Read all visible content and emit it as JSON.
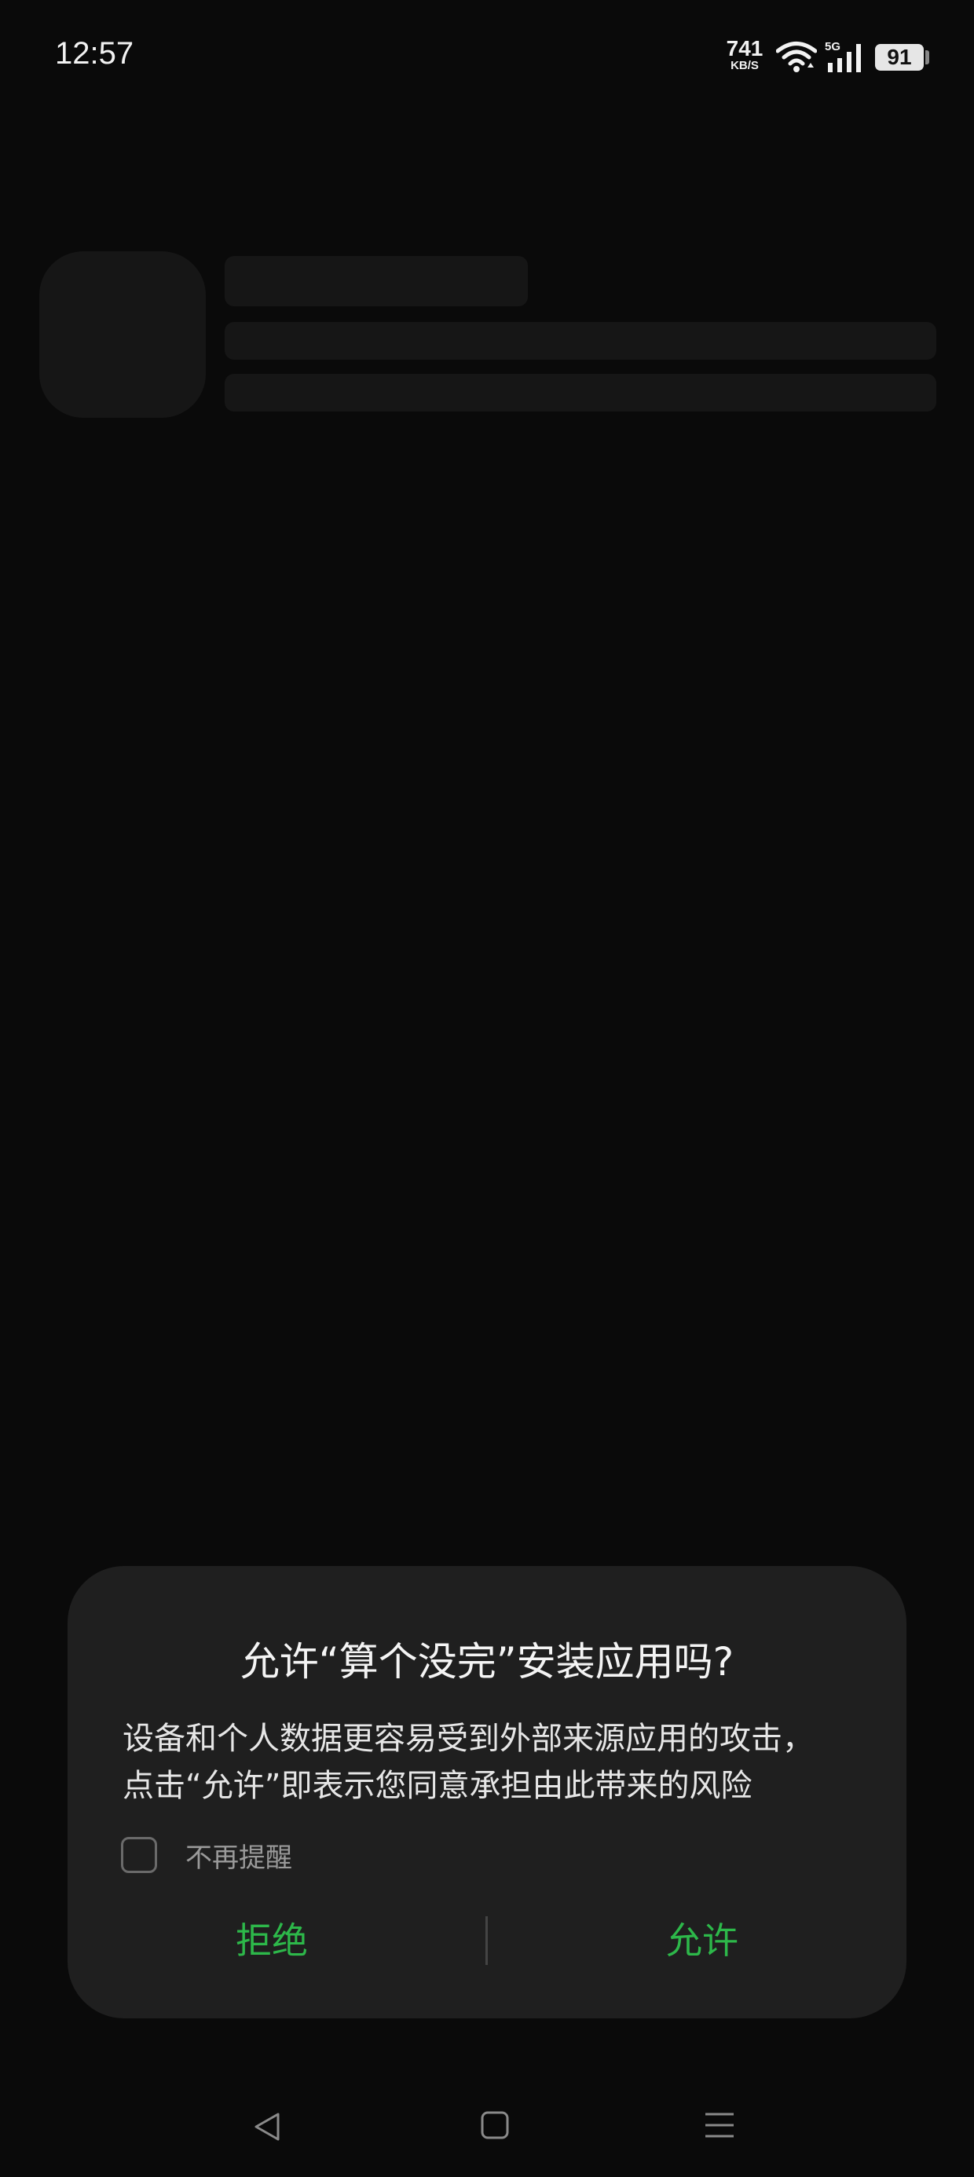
{
  "status_bar": {
    "time": "12:57",
    "network_speed_value": "741",
    "network_speed_unit": "KB/S",
    "network_type": "5G",
    "battery_level": "91",
    "icons": [
      "wifi-icon",
      "signal-5g-icon",
      "battery-icon"
    ]
  },
  "dialog": {
    "title": "允许“算个没完”安装应用吗?",
    "message": "设备和个人数据更容易受到外部来源应用的攻击，\n点击“允许”即表示您同意承担由此带来的风险",
    "checkbox_label": "不再提醒",
    "checkbox_checked": false,
    "deny_label": "拒绝",
    "allow_label": "允许",
    "accent_color": "#2db84a"
  },
  "nav_bar": {
    "icons": [
      "back-icon",
      "home-icon",
      "recents-icon"
    ]
  }
}
